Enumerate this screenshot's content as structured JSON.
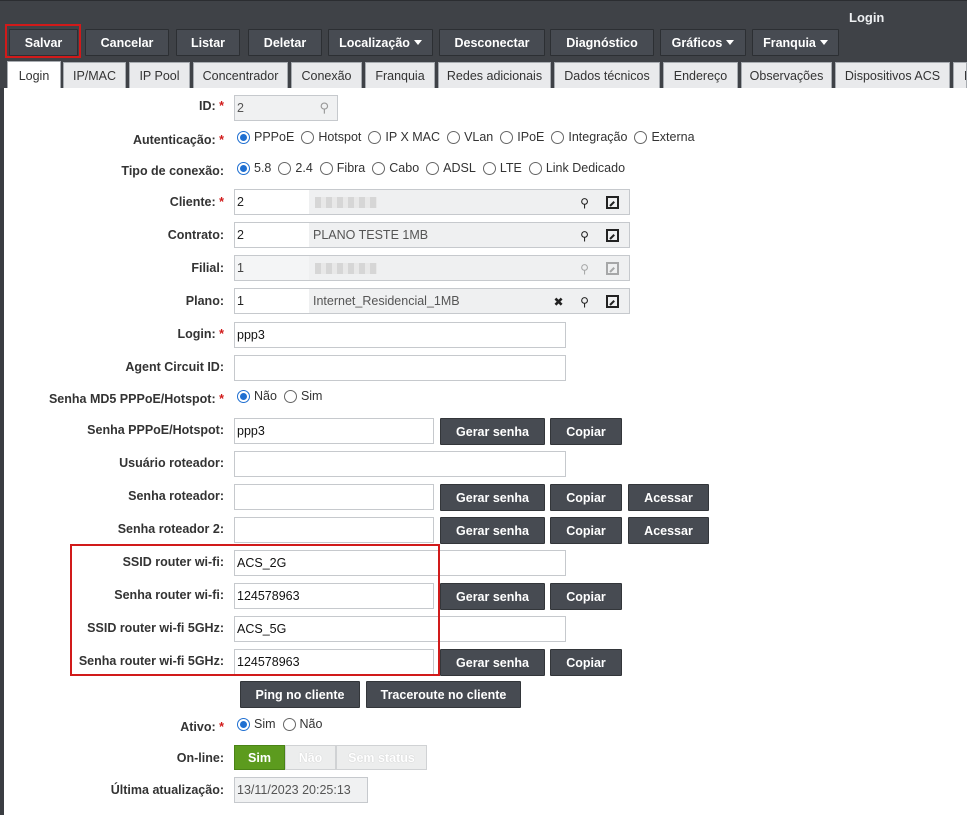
{
  "window_title": "Login",
  "toolbar": {
    "salvar": "Salvar",
    "cancelar": "Cancelar",
    "listar": "Listar",
    "deletar": "Deletar",
    "localizacao": "Localização",
    "desconectar": "Desconectar",
    "diagnostico": "Diagnóstico",
    "graficos": "Gráficos",
    "franquia": "Franquia"
  },
  "tabs": [
    "Login",
    "IP/MAC",
    "IP Pool",
    "Concentrador",
    "Conexão",
    "Franquia",
    "Redes adicionais",
    "Dados técnicos",
    "Endereço",
    "Observações",
    "Dispositivos ACS",
    "F"
  ],
  "form": {
    "id": {
      "label": "ID:",
      "value": "2"
    },
    "autenticacao": {
      "label": "Autenticação:",
      "options": [
        "PPPoE",
        "Hotspot",
        "IP X MAC",
        "VLan",
        "IPoE",
        "Integração",
        "Externa"
      ],
      "selected": "PPPoE"
    },
    "tipo_conexao": {
      "label": "Tipo de conexão:",
      "options": [
        "5.8",
        "2.4",
        "Fibra",
        "Cabo",
        "ADSL",
        "LTE",
        "Link Dedicado"
      ],
      "selected": "5.8"
    },
    "cliente": {
      "label": "Cliente:",
      "value": "2"
    },
    "contrato": {
      "label": "Contrato:",
      "value": "2",
      "description": "PLANO TESTE 1MB"
    },
    "filial": {
      "label": "Filial:",
      "value": "1"
    },
    "plano": {
      "label": "Plano:",
      "value": "1",
      "description": "Internet_Residencial_1MB"
    },
    "login": {
      "label": "Login:",
      "value": "ppp3"
    },
    "agent_circuit_id": {
      "label": "Agent Circuit ID:",
      "value": ""
    },
    "senha_md5": {
      "label": "Senha MD5 PPPoE/Hotspot:",
      "options": [
        "Não",
        "Sim"
      ],
      "selected": "Não"
    },
    "senha_pppoe": {
      "label": "Senha PPPoE/Hotspot:",
      "value": "ppp3"
    },
    "usuario_roteador": {
      "label": "Usuário roteador:",
      "value": ""
    },
    "senha_roteador": {
      "label": "Senha roteador:",
      "value": ""
    },
    "senha_roteador2": {
      "label": "Senha roteador 2:",
      "value": ""
    },
    "ssid_wifi": {
      "label": "SSID router wi-fi:",
      "value": "ACS_2G"
    },
    "senha_wifi": {
      "label": "Senha router wi-fi:",
      "value": "124578963"
    },
    "ssid_wifi_5g": {
      "label": "SSID router wi-fi 5GHz:",
      "value": "ACS_5G"
    },
    "senha_wifi_5g": {
      "label": "Senha router wi-fi 5GHz:",
      "value": "124578963"
    },
    "ativo": {
      "label": "Ativo:",
      "options": [
        "Sim",
        "Não"
      ],
      "selected": "Sim"
    },
    "online": {
      "label": "On-line:",
      "options": [
        "Sim",
        "Não",
        "Sem status"
      ],
      "selected": "Sim"
    },
    "ultima_atualizacao": {
      "label": "Última atualização:",
      "value": "13/11/2023 20:25:13"
    }
  },
  "buttons": {
    "gerar_senha": "Gerar senha",
    "copiar": "Copiar",
    "acessar": "Acessar",
    "ping": "Ping no cliente",
    "traceroute": "Traceroute no cliente"
  },
  "required_mark": "*",
  "colors": {
    "toolbar_bg": "#3f4247",
    "button_bg": "#474b52",
    "highlight": "#d11a1a",
    "online_green": "#5c9b1e",
    "radio_blue": "#1f6fd1"
  }
}
